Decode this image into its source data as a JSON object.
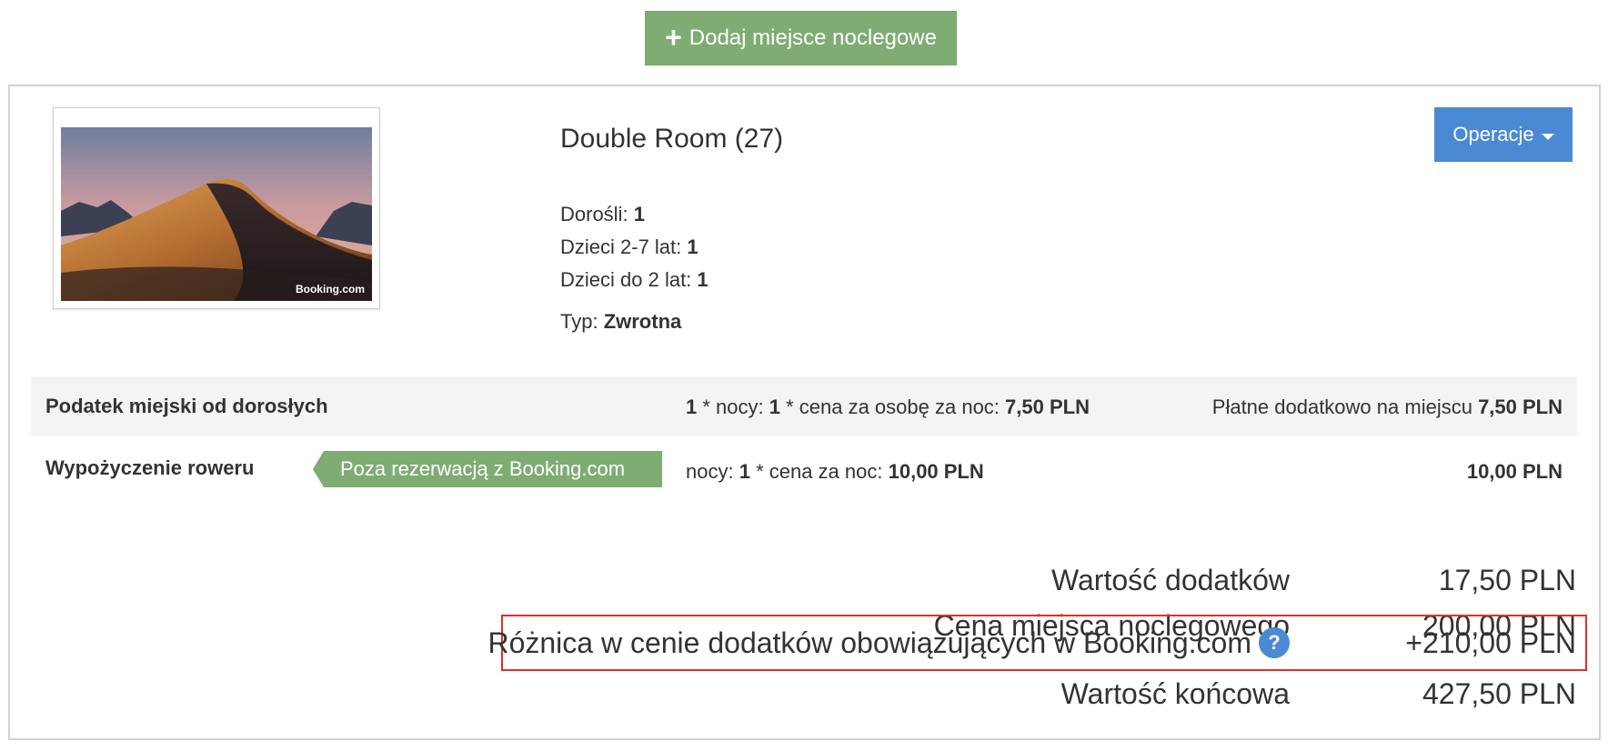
{
  "add_button": {
    "icon": "plus-icon",
    "label": "Dodaj miejsce noclegowe"
  },
  "room": {
    "title": "Double Room (27)",
    "image": {
      "watermark": "Booking.com"
    },
    "occupancy": [
      {
        "label": "Dorośli: ",
        "value": "1"
      },
      {
        "label": "Dzieci 2-7 lat: ",
        "value": "1"
      },
      {
        "label": "Dzieci do 2 lat: ",
        "value": "1"
      }
    ],
    "type": {
      "label": "Typ: ",
      "value": "Zwrotna"
    }
  },
  "operations_button": {
    "label": "Operacje",
    "icon": "caret-down-icon"
  },
  "extras": [
    {
      "name": "Podatek miejski od dorosłych",
      "calc": {
        "q1": "1",
        "t1": " * nocy: ",
        "q2": "1",
        "t2": " * cena za osobę za noc: ",
        "price": "7,50 PLN"
      },
      "right": {
        "label": "Płatne dodatkowo na miejscu ",
        "value": "7,50 PLN"
      }
    },
    {
      "name": "Wypożyczenie roweru",
      "tag": "Poza rezerwacją z Booking.com",
      "calc": {
        "t1": "nocy: ",
        "q1": "1",
        "t2": " * cena za noc: ",
        "price": "10,00 PLN"
      },
      "right": {
        "value": "10,00 PLN"
      }
    }
  ],
  "summary": [
    {
      "label": "Wartość dodatków",
      "value": "17,50 PLN"
    },
    {
      "label": "Cena miejsca noclegowego",
      "value": "200,00 PLN"
    },
    {
      "label": "Różnica w cenie dodatków obowiązujących w Booking.com",
      "value": "+210,00 PLN",
      "help_icon": "?"
    },
    {
      "label": "Wartość końcowa",
      "value": "427,50 PLN"
    }
  ],
  "colors": {
    "green": "#7fac72",
    "blue": "#4a89d4",
    "highlight_border": "#e0302c"
  }
}
